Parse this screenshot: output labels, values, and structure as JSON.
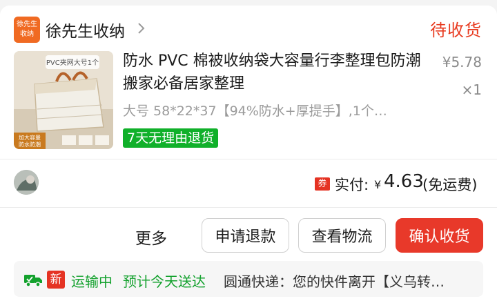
{
  "shop": {
    "logo_text_line1": "徐先生",
    "logo_text_line2": "收纳",
    "name": "徐先生收纳",
    "brand_color": "#f06a22"
  },
  "order": {
    "status": "待收货",
    "status_color": "#e83a1f"
  },
  "product": {
    "title": "防水 PVC 棉被收纳袋大容量行李整理包防潮搬家必备居家整理",
    "price": "¥5.78",
    "quantity": "×1",
    "sku": "大号 58*22*37【94%防水+厚提手】,1个…",
    "badge": "7天无理由退货",
    "badge_color": "#10b02a",
    "thumb_label_top": "PVC夹网大号1个",
    "thumb_label_bottom_1": "加大容量",
    "thumb_label_bottom_2": "防水防潮"
  },
  "payment": {
    "coupon_icon_text": "券",
    "paid_label": "实付:",
    "currency": "¥",
    "amount": "4.63",
    "shipping": "(免运费)"
  },
  "actions": {
    "more": "更多",
    "refund": "申请退款",
    "logistics": "查看物流",
    "confirm": "确认收货",
    "confirm_color": "#e8392a"
  },
  "logistics": {
    "new_tag": "新",
    "status": "运输中",
    "eta": "预计今天送达",
    "detail": "圆通快递：您的快件离开【义乌转…",
    "status_color": "#13a12d"
  }
}
